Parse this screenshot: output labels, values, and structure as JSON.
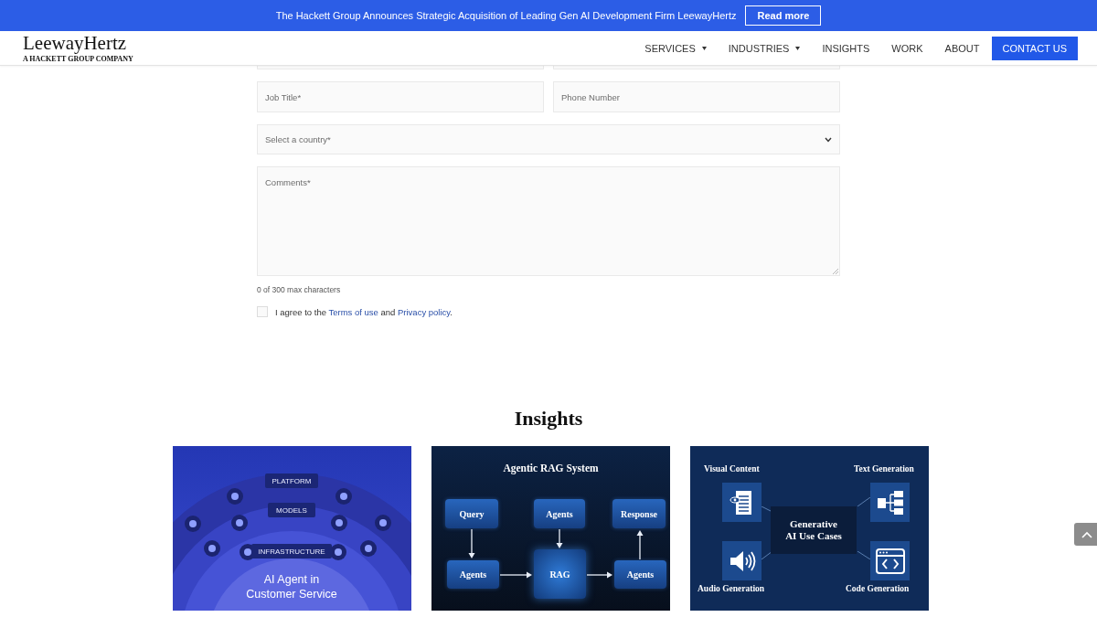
{
  "announcement": {
    "text": "The Hackett Group Announces Strategic Acquisition of Leading Gen AI Development Firm LeewayHertz",
    "button": "Read more"
  },
  "header": {
    "logo": "LeewayHertz",
    "tagline": "A HACKETT GROUP COMPANY",
    "nav": [
      {
        "label": "SERVICES",
        "dropdown": true
      },
      {
        "label": "INDUSTRIES",
        "dropdown": true
      },
      {
        "label": "INSIGHTS",
        "dropdown": false
      },
      {
        "label": "WORK",
        "dropdown": false
      },
      {
        "label": "ABOUT",
        "dropdown": false
      }
    ],
    "cta": "CONTACT US"
  },
  "form": {
    "rows": [
      [
        {
          "kind": "clipped"
        },
        {
          "kind": "clipped"
        }
      ],
      [
        {
          "kind": "text",
          "placeholder": "Job Title*"
        },
        {
          "kind": "text",
          "placeholder": "Phone Number"
        }
      ],
      [
        {
          "kind": "select",
          "placeholder": "Select a country*"
        }
      ],
      [
        {
          "kind": "textarea",
          "placeholder": "Comments*"
        }
      ]
    ],
    "counter": "0 of 300 max characters",
    "consent": {
      "checked": false,
      "before": "I agree to the",
      "link1": "Terms of use",
      "middle": "and",
      "link2": "Privacy policy",
      "after": "."
    }
  },
  "insights": {
    "title": "Insights",
    "cards": [
      {
        "kind": "platform",
        "layers": [
          "PLATFORM",
          "MODELS",
          "INFRASTRUCTURE"
        ],
        "title_lines": [
          "AI Agent in",
          "Customer Service"
        ]
      },
      {
        "kind": "flow",
        "title": "Agentic RAG System",
        "nodes": [
          "Query",
          "Agents",
          "Response",
          "Agents",
          "RAG",
          "Agents"
        ]
      },
      {
        "kind": "usecases",
        "items": [
          "Visual Content",
          "Text Generation",
          "Audio Generation",
          "Code Generation"
        ],
        "title_lines": [
          "Generative",
          "AI Use Cases"
        ]
      }
    ]
  }
}
